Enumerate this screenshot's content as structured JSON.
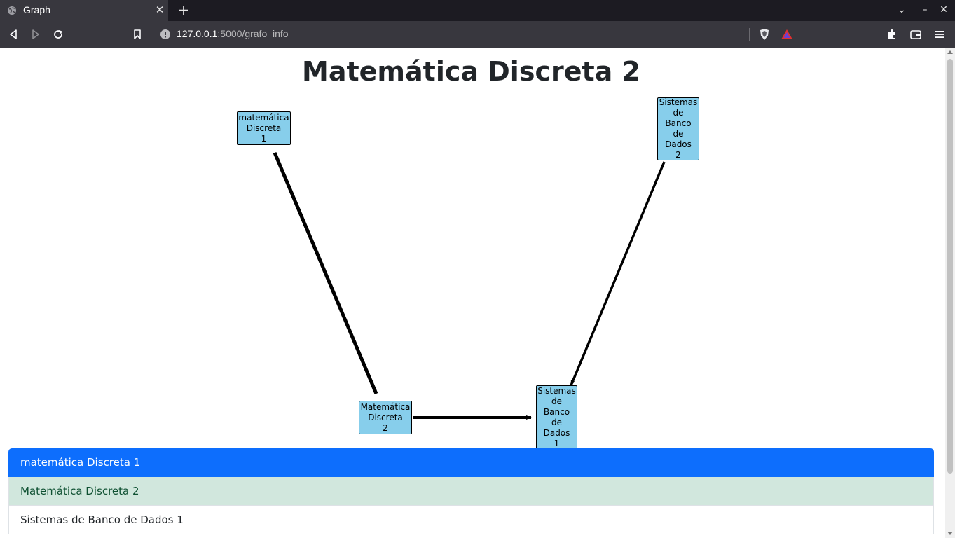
{
  "browser": {
    "tab_title": "Graph",
    "url_host": "127.0.0.1",
    "url_rest": ":5000/grafo_info"
  },
  "page": {
    "title": "Matemática Discreta 2"
  },
  "graph": {
    "nodes": [
      {
        "id": "md1",
        "label": "matemática\nDiscreta\n1"
      },
      {
        "id": "md2",
        "label": "Matemática\nDiscreta\n2"
      },
      {
        "id": "sbd1",
        "label": "Sistemas\nde\nBanco\nde\nDados\n1"
      },
      {
        "id": "sbd2",
        "label": "Sistemas\nde\nBanco\nde\nDados\n2"
      }
    ],
    "edges": [
      {
        "from": "md1",
        "to": "md2"
      },
      {
        "from": "md2",
        "to": "sbd1"
      },
      {
        "from": "sbd2",
        "to": "sbd1"
      }
    ]
  },
  "list": {
    "items": [
      {
        "label": "matemática Discreta 1",
        "state": "active"
      },
      {
        "label": "Matemática Discreta 2",
        "state": "success"
      },
      {
        "label": "Sistemas de Banco de Dados 1",
        "state": "default"
      }
    ]
  }
}
